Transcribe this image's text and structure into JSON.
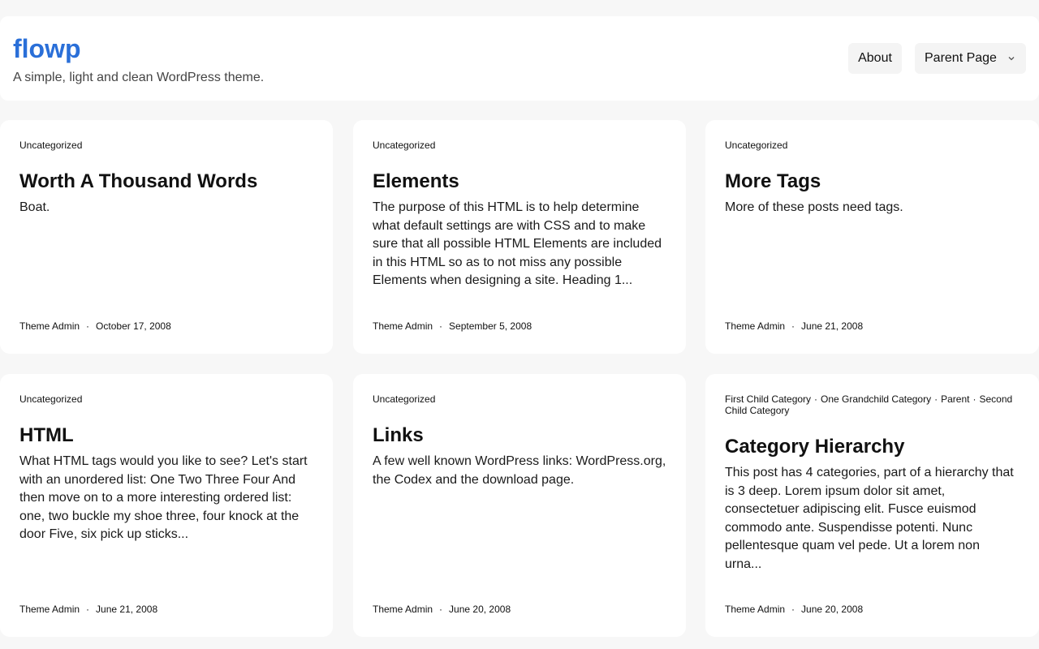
{
  "site": {
    "title": "flowp",
    "description": "A simple, light and clean WordPress theme."
  },
  "nav": {
    "about": "About",
    "parent_page": "Parent Page"
  },
  "posts": [
    {
      "categories": [
        "Uncategorized"
      ],
      "title": "Worth A Thousand Words",
      "excerpt": "Boat.",
      "author": "Theme Admin",
      "date": "October 17, 2008"
    },
    {
      "categories": [
        "Uncategorized"
      ],
      "title": "Elements",
      "excerpt": "The purpose of this HTML is to help determine what default settings are with CSS and to make sure that all possible HTML Elements are included in this HTML so as to not miss any possible Elements when designing a site. Heading 1...",
      "author": "Theme Admin",
      "date": "September 5, 2008"
    },
    {
      "categories": [
        "Uncategorized"
      ],
      "title": "More Tags",
      "excerpt": "More of these posts need tags.",
      "author": "Theme Admin",
      "date": "June 21, 2008"
    },
    {
      "categories": [
        "Uncategorized"
      ],
      "title": "HTML",
      "excerpt": "What HTML tags would you like to see? Let's start with an unordered list: One Two Three Four And then move on to a more interesting ordered list: one, two buckle my shoe three, four knock at the door Five, six pick up sticks...",
      "author": "Theme Admin",
      "date": "June 21, 2008"
    },
    {
      "categories": [
        "Uncategorized"
      ],
      "title": "Links",
      "excerpt": "A few well known WordPress links: WordPress.org, the Codex and the download page.",
      "author": "Theme Admin",
      "date": "June 20, 2008"
    },
    {
      "categories": [
        "First Child Category",
        "One Grandchild Category",
        "Parent",
        "Second Child Category"
      ],
      "title": "Category Hierarchy",
      "excerpt": "This post has 4 categories, part of a hierarchy that is 3 deep. Lorem ipsum dolor sit amet, consectetuer adipiscing elit. Fusce euismod commodo ante. Suspendisse potenti. Nunc pellentesque quam vel pede. Ut a lorem non urna...",
      "author": "Theme Admin",
      "date": "June 20, 2008"
    }
  ]
}
